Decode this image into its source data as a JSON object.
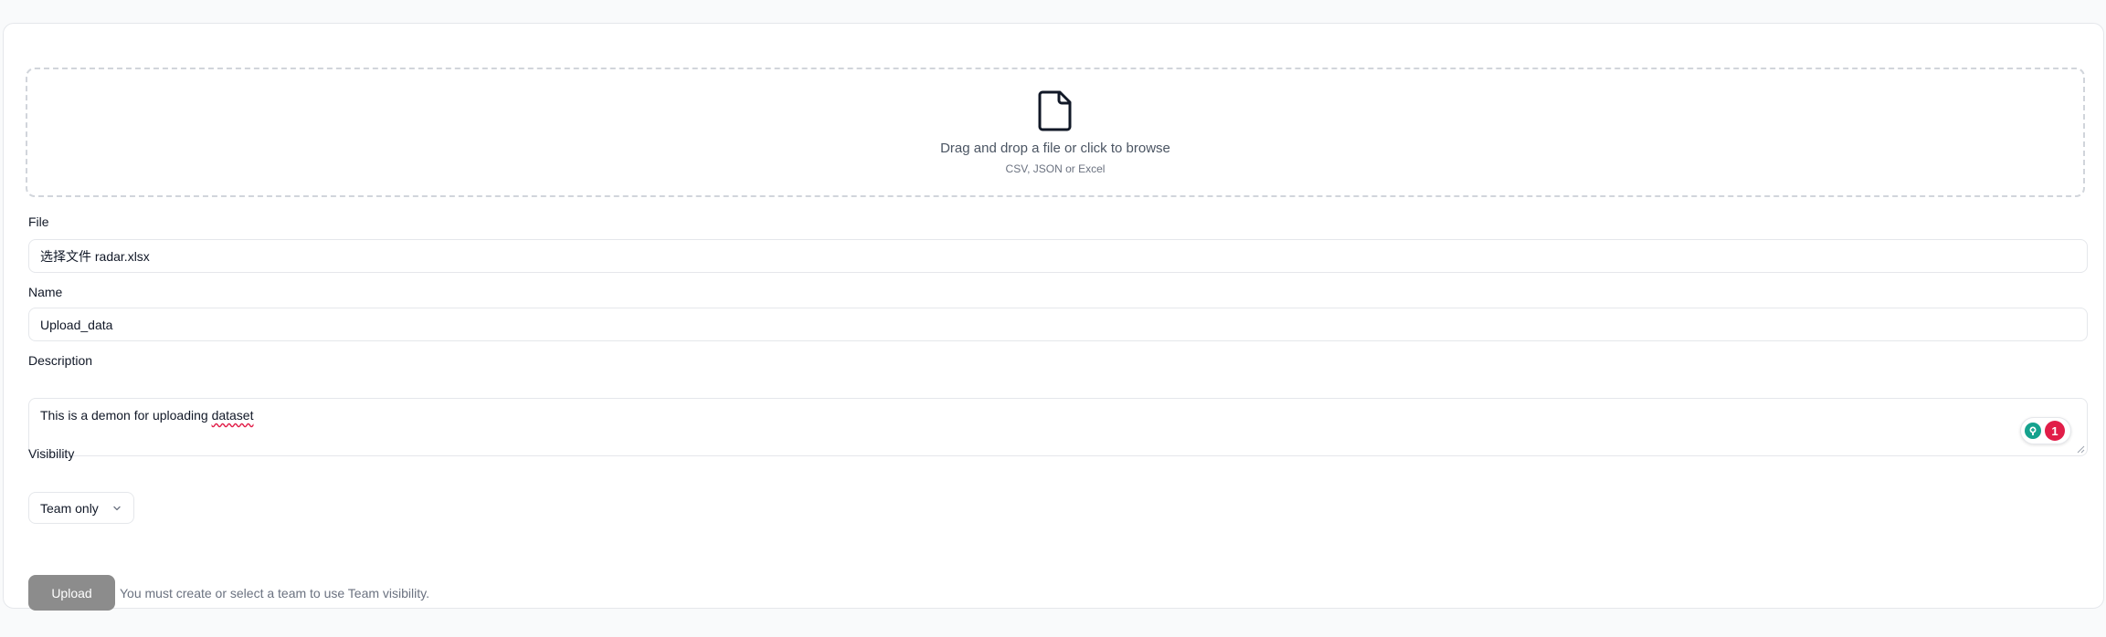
{
  "dropzone": {
    "title": "Drag and drop a file or click to browse",
    "subtitle": "CSV, JSON or Excel"
  },
  "form": {
    "file": {
      "label": "File",
      "value": "选择文件 radar.xlsx"
    },
    "name": {
      "label": "Name",
      "value": "Upload_data"
    },
    "description": {
      "label": "Description",
      "value_prefix": "This is a demon for uploading ",
      "value_flagged": "dataset",
      "suggestion_count": "1"
    },
    "visibility": {
      "label": "Visibility",
      "selected": "Team only"
    }
  },
  "actions": {
    "upload_label": "Upload",
    "hint": "You must create or select a team to use Team visibility."
  },
  "colors": {
    "upload_button": "#8c8c8c",
    "spellcheck": "#e11d48",
    "grammar_logo": "#15a28e"
  },
  "icons": {
    "dropzone": "file-icon",
    "select": "chevron-down-icon",
    "grammar": "grammar-assistant-icon"
  }
}
